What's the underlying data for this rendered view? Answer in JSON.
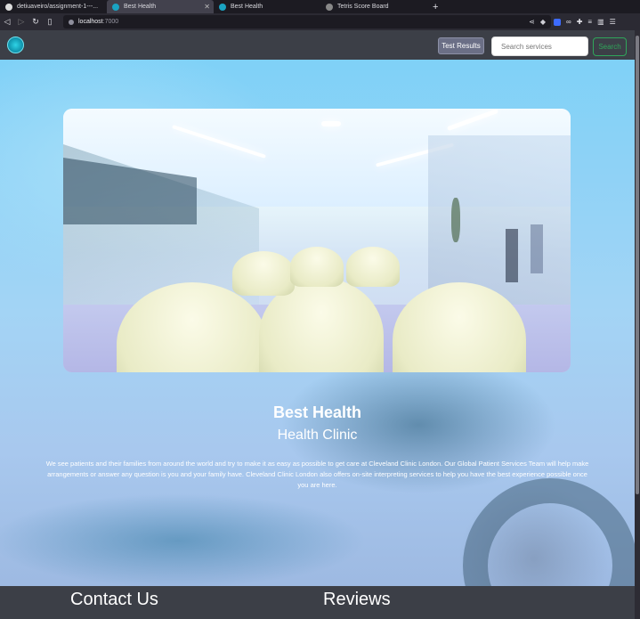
{
  "browser": {
    "tabs": [
      {
        "title": "detiuaveiro/assignment-1---..."
      },
      {
        "title": "Best Health"
      },
      {
        "title": "Best Health"
      },
      {
        "title": "Tetris Score Board"
      }
    ],
    "new_tab": "+",
    "url_host": "localhost",
    "url_port": ":7000"
  },
  "navbar": {
    "test_results_label": "Test Results",
    "search_placeholder": "Search services",
    "search_label": "Search"
  },
  "hero": {
    "title": "Best Health",
    "subtitle": "Health Clinic",
    "description": "We see patients and their families from around the world and try to make it as easy as possible to get care at Cleveland Clinic London. Our Global Patient Services Team will help make arrangements or answer any question is you and your family have. Cleveland Clinic London also offers on-site interpreting services to help you have the best experience possible once you are here."
  },
  "footer": {
    "contact": "Contact Us",
    "reviews": "Reviews"
  },
  "colors": {
    "navbar": "#3c3f47",
    "search_button": "#2fa65a",
    "test_results_button": "#6b6f86"
  }
}
